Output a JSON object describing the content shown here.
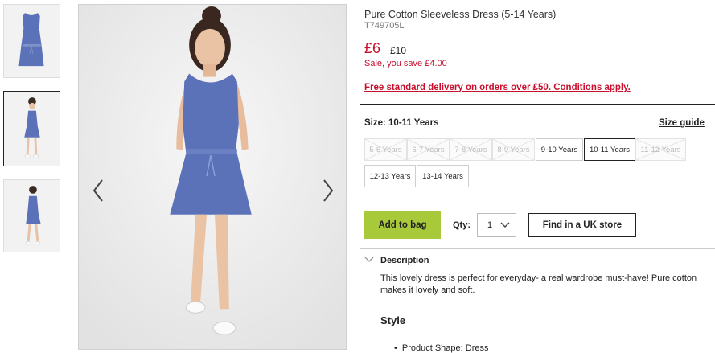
{
  "product": {
    "title": "Pure Cotton Sleeveless Dress (5-14 Years)",
    "code": "T749705L",
    "price": "£6",
    "was_price": "£10",
    "sale_text": "Sale, you save £4.00",
    "delivery_text": "Free standard delivery on orders over £50. Conditions apply."
  },
  "size": {
    "label": "Size: 10-11 Years",
    "guide_label": "Size guide",
    "options": [
      {
        "label": "5-6 Years",
        "available": false
      },
      {
        "label": "6-7 Years",
        "available": false
      },
      {
        "label": "7-8 Years",
        "available": false
      },
      {
        "label": "8-9 Years",
        "available": false
      },
      {
        "label": "9-10 Years",
        "available": true
      },
      {
        "label": "10-11 Years",
        "available": true,
        "selected": true
      },
      {
        "label": "11-12 Years",
        "available": false
      },
      {
        "label": "12-13 Years",
        "available": true
      },
      {
        "label": "13-14 Years",
        "available": true
      }
    ]
  },
  "actions": {
    "add_to_bag": "Add to bag",
    "qty_label": "Qty:",
    "qty_value": "1",
    "find_store": "Find in a UK store"
  },
  "description": {
    "heading": "Description",
    "text": "This lovely dress is perfect for everyday- a real wardrobe must-have! Pure cotton makes it lovely and soft.",
    "style_heading": "Style",
    "bullets": [
      "Product Shape: Dress"
    ]
  },
  "colors": {
    "accent_red": "#c8102e",
    "add_to_bag_green": "#a8c93a",
    "dress_blue": "#5b72b8"
  },
  "icons": {
    "prev": "chevron-left-icon",
    "next": "chevron-right-icon",
    "qty_dropdown": "chevron-down-icon",
    "description_toggle": "chevron-down-icon"
  }
}
